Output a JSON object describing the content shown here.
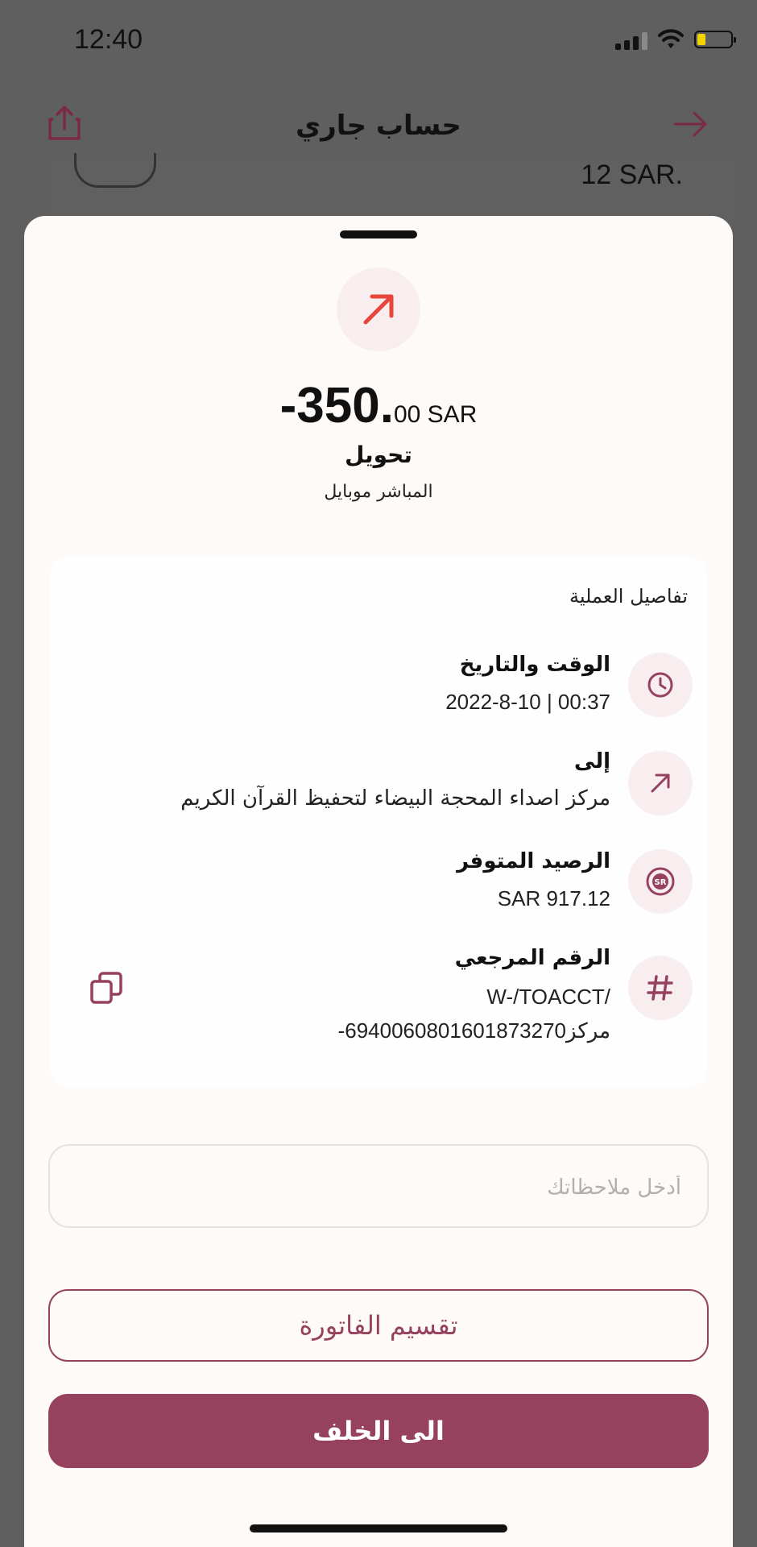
{
  "status_bar": {
    "time": "12:40"
  },
  "background_screen": {
    "title": "حساب جاري",
    "amount": "12 SAR."
  },
  "sheet": {
    "amount_main": "-350.",
    "amount_fraction": "00 SAR",
    "transaction_type": "تحويل",
    "channel": "المباشر موبايل",
    "details": {
      "title": "تفاصيل العملية",
      "rows": [
        {
          "icon": "clock-icon",
          "label": "الوقت والتاريخ",
          "value": "2022-8-10   |   00:37"
        },
        {
          "icon": "arrow-up-right-icon",
          "label": "إلى",
          "value": "مركز اصداء المحجة البيضاء لتحفيظ القرآن الكريم"
        },
        {
          "icon": "sar-coin-icon",
          "label": "الرصيد المتوفر",
          "value": "SAR 917.12"
        },
        {
          "icon": "hash-icon",
          "label": "الرقم المرجعي",
          "value_line1": "W-/TOACCT/",
          "value_line2": "-مركز6940060801601873270"
        }
      ]
    },
    "notes_placeholder": "أدخل ملاحظاتك",
    "split_bill_label": "تقسيم الفاتورة",
    "back_label": "الى الخلف"
  },
  "colors": {
    "accent": "#96425e",
    "icon_red": "#e8453c",
    "sheet_bg": "#fdfaf8"
  }
}
